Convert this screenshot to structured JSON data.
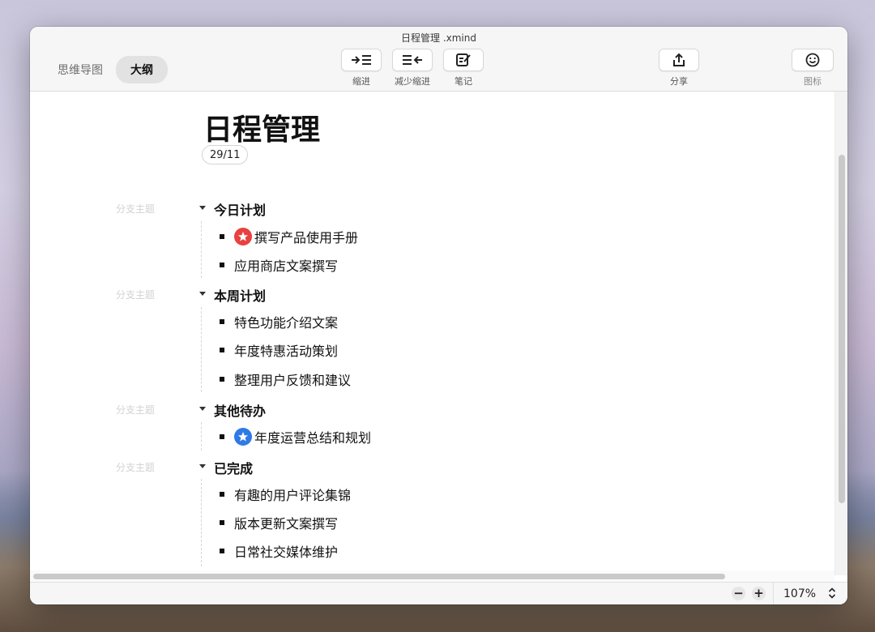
{
  "window": {
    "title": "日程管理 .xmind"
  },
  "view_switch": {
    "mindmap": "思维导图",
    "outline": "大纲",
    "active": "outline"
  },
  "toolbar": {
    "indent": "缩进",
    "outdent": "减少缩进",
    "note": "笔记",
    "share": "分享",
    "icon": "图标"
  },
  "document": {
    "title": "日程管理",
    "date": "29/11",
    "branch_hint": "分支主题",
    "branches": [
      {
        "title": "今日计划",
        "items": [
          {
            "text": "撰写产品使用手册",
            "marker": "red-star"
          },
          {
            "text": "应用商店文案撰写"
          }
        ]
      },
      {
        "title": "本周计划",
        "items": [
          {
            "text": "特色功能介绍文案"
          },
          {
            "text": "年度特惠活动策划"
          },
          {
            "text": "整理用户反馈和建议"
          }
        ]
      },
      {
        "title": "其他待办",
        "items": [
          {
            "text": "年度运营总结和规划",
            "marker": "blue-star"
          }
        ]
      },
      {
        "title": "已完成",
        "items": [
          {
            "text": "有趣的用户评论集锦"
          },
          {
            "text": "版本更新文案撰写"
          },
          {
            "text": "日常社交媒体维护"
          }
        ]
      }
    ]
  },
  "status": {
    "zoom": "107%",
    "zoom_out": "−",
    "zoom_in": "+"
  },
  "colors": {
    "red_star": "#e8413f",
    "blue_star": "#2f7ae5"
  }
}
